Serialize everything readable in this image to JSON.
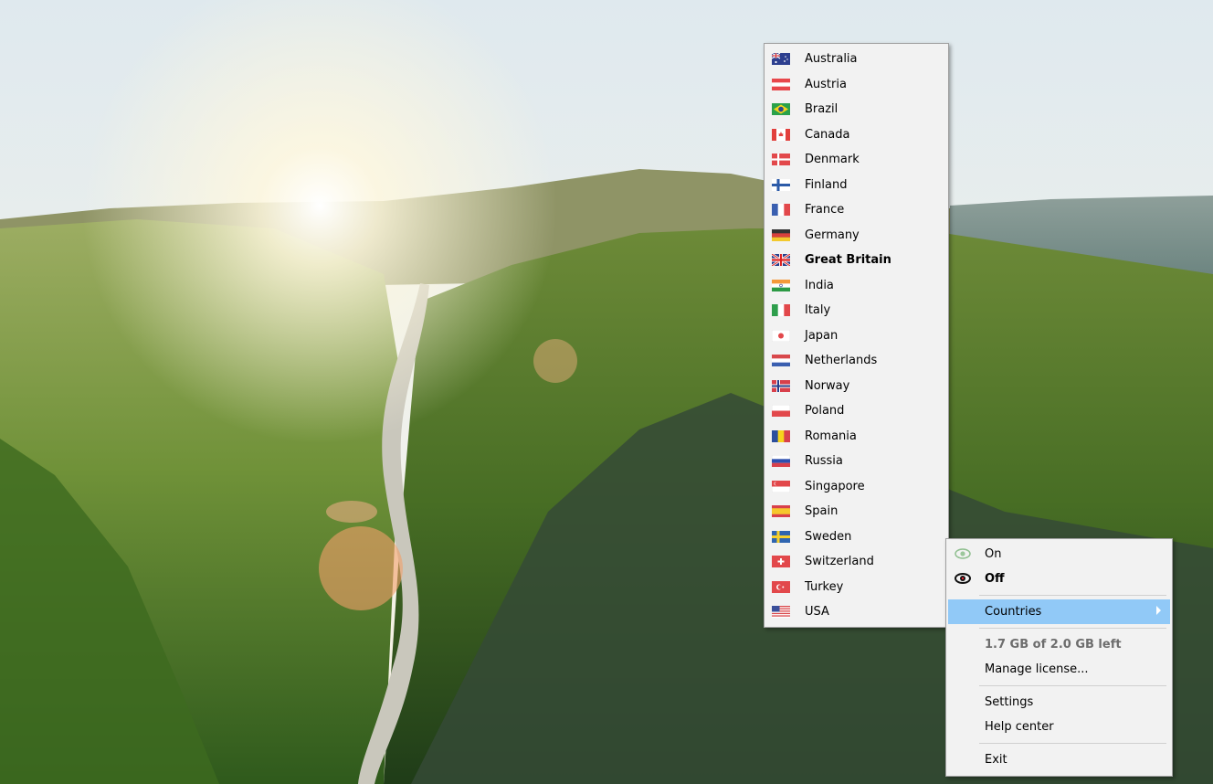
{
  "countries_menu": {
    "items": [
      {
        "label": "Australia",
        "flag": "australia-flag-icon"
      },
      {
        "label": "Austria",
        "flag": "austria-flag-icon"
      },
      {
        "label": "Brazil",
        "flag": "brazil-flag-icon"
      },
      {
        "label": "Canada",
        "flag": "canada-flag-icon"
      },
      {
        "label": "Denmark",
        "flag": "denmark-flag-icon"
      },
      {
        "label": "Finland",
        "flag": "finland-flag-icon"
      },
      {
        "label": "France",
        "flag": "france-flag-icon"
      },
      {
        "label": "Germany",
        "flag": "germany-flag-icon"
      },
      {
        "label": "Great Britain",
        "flag": "great-britain-flag-icon",
        "selected": true
      },
      {
        "label": "India",
        "flag": "india-flag-icon"
      },
      {
        "label": "Italy",
        "flag": "italy-flag-icon"
      },
      {
        "label": "Japan",
        "flag": "japan-flag-icon"
      },
      {
        "label": "Netherlands",
        "flag": "netherlands-flag-icon"
      },
      {
        "label": "Norway",
        "flag": "norway-flag-icon"
      },
      {
        "label": "Poland",
        "flag": "poland-flag-icon"
      },
      {
        "label": "Romania",
        "flag": "romania-flag-icon"
      },
      {
        "label": "Russia",
        "flag": "russia-flag-icon"
      },
      {
        "label": "Singapore",
        "flag": "singapore-flag-icon"
      },
      {
        "label": "Spain",
        "flag": "spain-flag-icon"
      },
      {
        "label": "Sweden",
        "flag": "sweden-flag-icon"
      },
      {
        "label": "Switzerland",
        "flag": "switzerland-flag-icon"
      },
      {
        "label": "Turkey",
        "flag": "turkey-flag-icon"
      },
      {
        "label": "USA",
        "flag": "usa-flag-icon"
      }
    ]
  },
  "tray_menu": {
    "on_label": "On",
    "off_label": "Off",
    "countries_label": "Countries",
    "usage_label": "1.7 GB of 2.0 GB left",
    "manage_license_label": "Manage license...",
    "settings_label": "Settings",
    "help_center_label": "Help center",
    "exit_label": "Exit"
  },
  "colors": {
    "menu_background": "#f2f2f2",
    "highlight": "#91c9f7"
  }
}
